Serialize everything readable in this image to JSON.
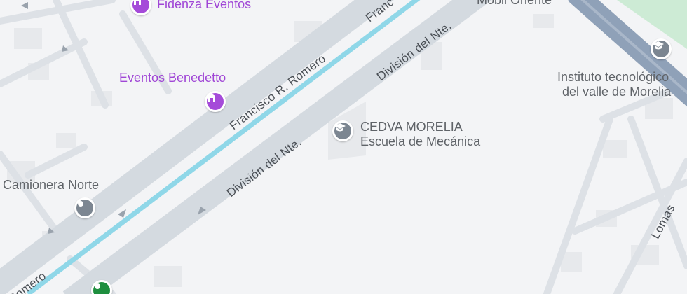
{
  "map": {
    "pois": [
      {
        "id": "fidenza",
        "name": "Fidenza Eventos",
        "icon": "event-venue-icon",
        "color": "#a046d6"
      },
      {
        "id": "benedetto",
        "name": "Eventos Benedetto",
        "icon": "event-venue-icon",
        "color": "#a046d6"
      },
      {
        "id": "mobil",
        "name": "Mobil Oriente"
      },
      {
        "id": "instituto",
        "line1": "Instituto tecnológico",
        "line2": "del valle de Morelia",
        "icon": "school-icon"
      },
      {
        "id": "cedva",
        "line1": "CEDVA MORELIA",
        "line2": "Escuela de Mecánica",
        "icon": "school-icon"
      },
      {
        "id": "camionera",
        "name": "Camionera Norte",
        "icon": "place-pin-icon"
      },
      {
        "id": "bottom-pin",
        "icon": "place-pin-icon",
        "color": "#1e8e3e"
      }
    ],
    "roads": {
      "francisco_upper": "Francisco R. Romero",
      "francisco_top": "Franc",
      "romero_bottom": "Romero",
      "division_upper": "División del Nte.",
      "division_lower": "División del Nte.",
      "lomas": "Lomas"
    },
    "colors": {
      "land": "#f3f4f6",
      "road": "#d6dbe1",
      "highway": "#8fa1b8",
      "water_line": "#8fd7e8",
      "park": "#cdebd5",
      "block": "#e6e8eb"
    }
  }
}
